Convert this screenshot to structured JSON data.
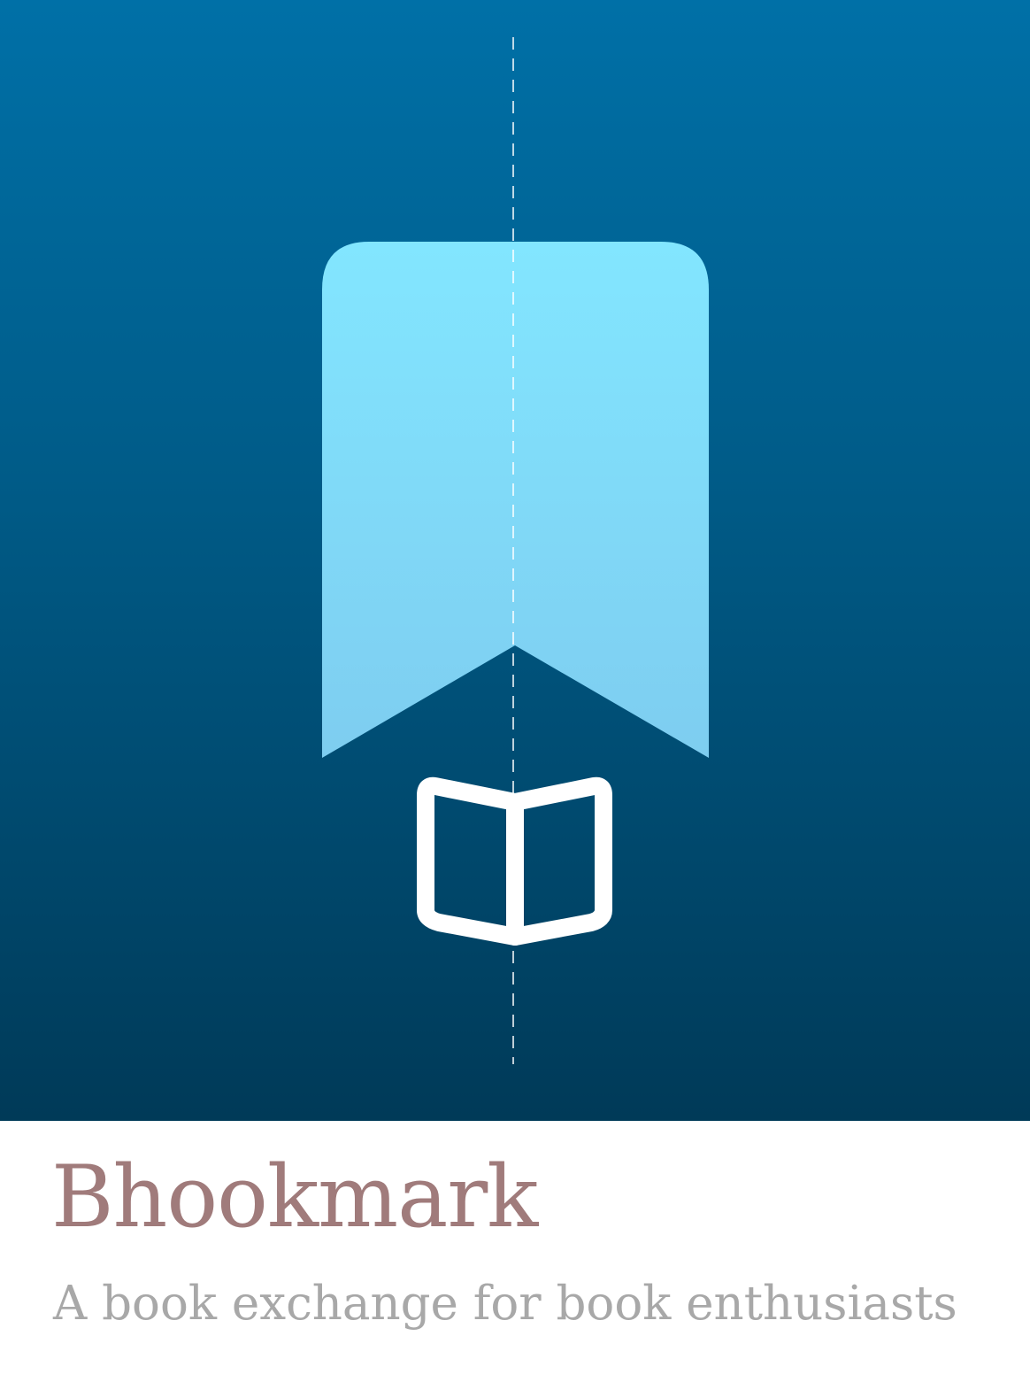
{
  "brand": {
    "name": "Bhookmark",
    "tagline": "A book exchange for book enthusiasts"
  },
  "icons": {
    "bookmark": "bookmark-icon",
    "book": "open-book-icon",
    "guide": "dashed-center-guide"
  },
  "colors": {
    "background_top": "#0070a7",
    "background_bottom": "#003a58",
    "bookmark_top": "#82e6ff",
    "bookmark_bottom": "#7ecdf0",
    "book_stroke": "#ffffff",
    "title": "#a07b7b",
    "tagline": "#a8a8a8",
    "caption_background": "#ffffff"
  }
}
